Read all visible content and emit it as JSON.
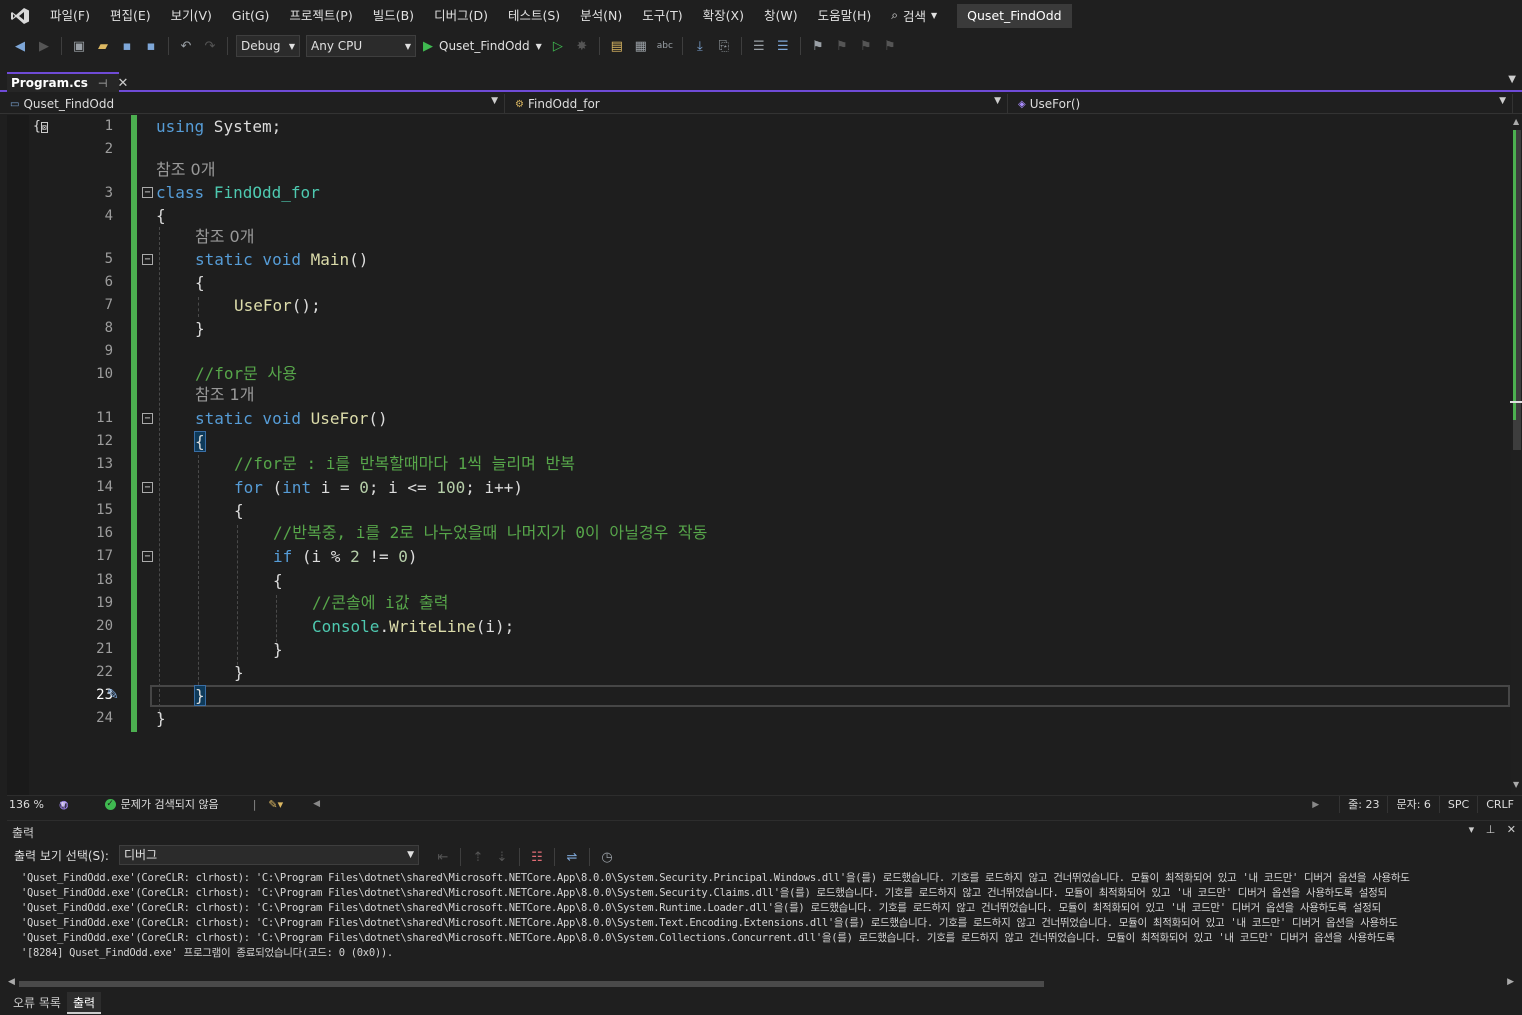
{
  "menu": {
    "items": [
      "파일(F)",
      "편집(E)",
      "보기(V)",
      "Git(G)",
      "프로젝트(P)",
      "빌드(B)",
      "디버그(D)",
      "테스트(S)",
      "분석(N)",
      "도구(T)",
      "확장(X)",
      "창(W)",
      "도움말(H)"
    ],
    "search_label": "검색",
    "solution_title": "Quset_FindOdd"
  },
  "toolbar": {
    "configuration": "Debug",
    "platform": "Any CPU",
    "run_target": "Quset_FindOdd"
  },
  "document_tab": {
    "title": "Program.cs"
  },
  "navbar": {
    "project": "Quset_FindOdd",
    "type": "FindOdd_for",
    "member": "UseFor()"
  },
  "editor": {
    "line_numbers": [
      "1",
      "2",
      "3",
      "4",
      "5",
      "6",
      "7",
      "8",
      "9",
      "10",
      "11",
      "12",
      "13",
      "14",
      "15",
      "16",
      "17",
      "18",
      "19",
      "20",
      "21",
      "22",
      "23",
      "24"
    ],
    "current_line": "23",
    "lenses": [
      "참조 0개",
      "참조 0개",
      "참조 1개"
    ],
    "code": {
      "l1_kw": "using",
      "l1_rest": " System;",
      "l3_kw": "class",
      "l3_type": "FindOdd_for",
      "l4": "{",
      "l5_kw": "static void",
      "l5_method": "Main",
      "l5_rest": "()",
      "l6": "{",
      "l7_method": "UseFor",
      "l7_rest": "();",
      "l8": "}",
      "l10_comment": "//for문 사용",
      "l11_kw": "static void",
      "l11_method": "UseFor",
      "l11_rest": "()",
      "l12": "{",
      "l13_comment": "//for문 : i를 반복할때마다 1씩 늘리며 반복",
      "l14_kw": "for",
      "l14_a": " (",
      "l14_kw2": "int",
      "l14_b": " i = ",
      "l14_n1": "0",
      "l14_c": "; i <= ",
      "l14_n2": "100",
      "l14_d": "; i++)",
      "l15": "{",
      "l16_comment": "//반복중, i를 2로 나누었을때 나머지가 0이 아닐경우 작동",
      "l17_kw": "if",
      "l17_a": " (i % ",
      "l17_n1": "2",
      "l17_b": " != ",
      "l17_n2": "0",
      "l17_c": ")",
      "l18": "{",
      "l19_comment": "//콘솔에 i값 출력",
      "l20_type": "Console",
      "l20_dot": ".",
      "l20_method": "WriteLine",
      "l20_rest": "(i);",
      "l21": "}",
      "l22": "}",
      "l23": "}",
      "l24": "}"
    }
  },
  "editor_status": {
    "zoom": "136 %",
    "issues": "문제가 검색되지 않음",
    "line": "줄: 23",
    "column": "문자: 6",
    "whitespace": "SPC",
    "line_ending": "CRLF"
  },
  "output": {
    "title": "출력",
    "source_label": "출력 보기 선택(S):",
    "source_value": "디버그",
    "lines": [
      "'Quset_FindOdd.exe'(CoreCLR: clrhost): 'C:\\Program Files\\dotnet\\shared\\Microsoft.NETCore.App\\8.0.0\\System.Security.Principal.Windows.dll'을(를) 로드했습니다. 기호를 로드하지 않고 건너뛰었습니다. 모듈이 최적화되어 있고 '내 코드만' 디버거 옵션을 사용하도",
      "'Quset_FindOdd.exe'(CoreCLR: clrhost): 'C:\\Program Files\\dotnet\\shared\\Microsoft.NETCore.App\\8.0.0\\System.Security.Claims.dll'을(를) 로드했습니다. 기호를 로드하지 않고 건너뛰었습니다. 모듈이 최적화되어 있고 '내 코드만' 디버거 옵션을 사용하도록 설정되",
      "'Quset_FindOdd.exe'(CoreCLR: clrhost): 'C:\\Program Files\\dotnet\\shared\\Microsoft.NETCore.App\\8.0.0\\System.Runtime.Loader.dll'을(를) 로드했습니다. 기호를 로드하지 않고 건너뛰었습니다. 모듈이 최적화되어 있고 '내 코드만' 디버거 옵션을 사용하도록 설정되",
      "'Quset_FindOdd.exe'(CoreCLR: clrhost): 'C:\\Program Files\\dotnet\\shared\\Microsoft.NETCore.App\\8.0.0\\System.Text.Encoding.Extensions.dll'을(를) 로드했습니다. 기호를 로드하지 않고 건너뛰었습니다. 모듈이 최적화되어 있고 '내 코드만' 디버거 옵션을 사용하도",
      "'Quset_FindOdd.exe'(CoreCLR: clrhost): 'C:\\Program Files\\dotnet\\shared\\Microsoft.NETCore.App\\8.0.0\\System.Collections.Concurrent.dll'을(를) 로드했습니다. 기호를 로드하지 않고 건너뛰었습니다. 모듈이 최적화되어 있고 '내 코드만' 디버거 옵션을 사용하도록",
      "'[8284] Quset_FindOdd.exe' 프로그램이 종료되었습니다(코드: 0 (0x0))."
    ]
  },
  "bottom_tabs": [
    "오류 목록",
    "출력"
  ],
  "colors": {
    "accent": "#6f4bd6",
    "change_bar": "#4caf50",
    "keyword": "#569cd6",
    "type": "#4ec9b0",
    "method": "#dcdcaa",
    "comment": "#57a64a",
    "number": "#b5cea8"
  },
  "icons": [
    "vs-logo-icon",
    "search-icon",
    "back-icon",
    "forward-icon",
    "new-project-icon",
    "open-icon",
    "save-icon",
    "save-all-icon",
    "undo-icon",
    "redo-icon",
    "play-icon",
    "start-without-debug-icon",
    "pin-icon",
    "close-icon",
    "quick-action-icon",
    "ok-check-icon",
    "clock-icon"
  ]
}
